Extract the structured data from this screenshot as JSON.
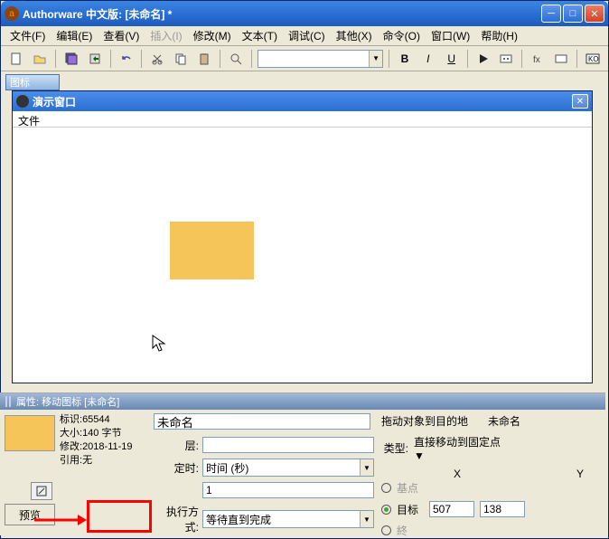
{
  "window": {
    "title": "Authorware 中文版: [未命名] *"
  },
  "menu": {
    "file": "文件(F)",
    "edit": "编辑(E)",
    "view": "查看(V)",
    "insert": "插入(I)",
    "modify": "修改(M)",
    "text": "文本(T)",
    "debug": "调试(C)",
    "other": "其他(X)",
    "command": "命令(O)",
    "window_menu": "窗口(W)",
    "help": "帮助(H)"
  },
  "toolbar_format": {
    "bold": "B",
    "italic": "I",
    "underline": "U"
  },
  "truncated_panel_label": "图标",
  "demo": {
    "title": "演示窗口",
    "file": "文件"
  },
  "properties": {
    "header": "属性: 移动图标 [未命名]",
    "info": {
      "id_label": "标识:",
      "id_value": "65544",
      "size_label": "大小:",
      "size_value": "140 字节",
      "modified_label": "修改:",
      "modified_value": "2018-11-19",
      "ref_label": "引用:",
      "ref_value": "无"
    },
    "preview": "预览",
    "name_value": "未命名",
    "drag_hint": "拖动对象到目的地",
    "dest_name": "未命名",
    "layer_label": "层:",
    "layer_value": "",
    "type_label": "类型:",
    "type_value": "直接移动到固定点",
    "timing_label": "定时:",
    "timing_value": "时间 (秒)",
    "timing_num": "1",
    "exec_label": "执行方式:",
    "exec_value": "等待直到完成",
    "x_label": "X",
    "y_label": "Y",
    "base_label": "基点",
    "target_label": "目标",
    "end_label": "終",
    "x_value": "507",
    "y_value": "138"
  }
}
